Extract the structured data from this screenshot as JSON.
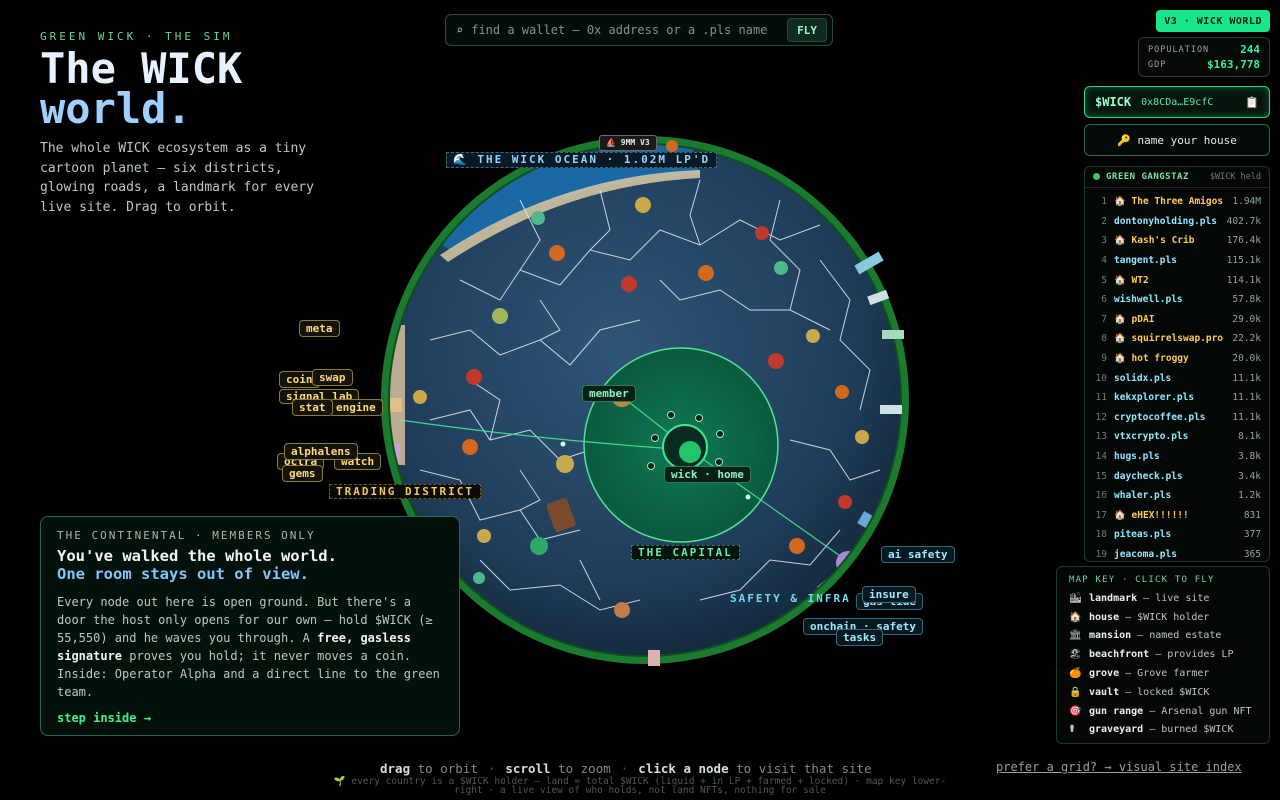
{
  "header": {
    "eyebrow": "GREEN WICK · THE SIM",
    "title_line1": "The WICK",
    "title_line2": "world.",
    "blurb": "The whole WICK ecosystem as a tiny cartoon planet — six districts, glowing roads, a landmark for every live site. Drag to orbit."
  },
  "search": {
    "icon": "search-icon",
    "placeholder": "find a wallet — 0x address or a .pls name",
    "button": "FLY"
  },
  "badge": "V3 · WICK WORLD",
  "stats": {
    "population_label": "POPULATION",
    "population": "244",
    "gdp_label": "GDP",
    "gdp": "$163,778"
  },
  "token": {
    "symbol": "$WICK",
    "address": "0x8CDa…E9cfC",
    "copy_icon": "📋"
  },
  "name_house": "🔑 name your house",
  "leaderboard": {
    "title": "GREEN GANGSTAZ",
    "subtitle": "$WICK held",
    "rows": [
      {
        "rank": "1",
        "name": "🏠 The Three Amigos",
        "value": "1.94M",
        "named": true
      },
      {
        "rank": "2",
        "name": "dontonyholding.pls",
        "value": "402.7k",
        "named": false
      },
      {
        "rank": "3",
        "name": "🏠 Kash's Crib",
        "value": "176.4k",
        "named": true
      },
      {
        "rank": "4",
        "name": "tangent.pls",
        "value": "115.1k",
        "named": false
      },
      {
        "rank": "5",
        "name": "🏠 WT2",
        "value": "114.1k",
        "named": true
      },
      {
        "rank": "6",
        "name": "wishwell.pls",
        "value": "57.8k",
        "named": false
      },
      {
        "rank": "7",
        "name": "🏠 pDAI",
        "value": "29.0k",
        "named": true
      },
      {
        "rank": "8",
        "name": "🏠 squirrelswap.pro",
        "value": "22.2k",
        "named": true
      },
      {
        "rank": "9",
        "name": "🏠 hot froggy",
        "value": "20.0k",
        "named": true
      },
      {
        "rank": "10",
        "name": "solidx.pls",
        "value": "11.1k",
        "named": false
      },
      {
        "rank": "11",
        "name": "kekxplorer.pls",
        "value": "11.1k",
        "named": false
      },
      {
        "rank": "12",
        "name": "cryptocoffee.pls",
        "value": "11.1k",
        "named": false
      },
      {
        "rank": "13",
        "name": "vtxcrypto.pls",
        "value": "8.1k",
        "named": false
      },
      {
        "rank": "14",
        "name": "hugs.pls",
        "value": "3.8k",
        "named": false
      },
      {
        "rank": "15",
        "name": "daycheck.pls",
        "value": "3.4k",
        "named": false
      },
      {
        "rank": "16",
        "name": "whaler.pls",
        "value": "1.2k",
        "named": false
      },
      {
        "rank": "17",
        "name": "🏠 eHEX!!!!!!",
        "value": "831",
        "named": true
      },
      {
        "rank": "18",
        "name": "piteas.pls",
        "value": "377",
        "named": false
      },
      {
        "rank": "19",
        "name": "jeacoma.pls",
        "value": "365",
        "named": false
      }
    ]
  },
  "mapkey": {
    "title": "MAP KEY · CLICK TO FLY",
    "items": [
      {
        "icon": "🏙",
        "name": "landmark",
        "desc": "— live site"
      },
      {
        "icon": "🏠",
        "name": "house",
        "desc": "— $WICK holder"
      },
      {
        "icon": "🏛",
        "name": "mansion",
        "desc": "— named estate"
      },
      {
        "icon": "🏖",
        "name": "beachfront",
        "desc": "— provides LP"
      },
      {
        "icon": "🍊",
        "name": "grove",
        "desc": "— Grove farmer"
      },
      {
        "icon": "🔒",
        "name": "vault",
        "desc": "— locked $WICK"
      },
      {
        "icon": "🎯",
        "name": "gun range",
        "desc": "— Arsenal gun NFT"
      },
      {
        "icon": "⚰",
        "name": "graveyard",
        "desc": "— burned $WICK"
      }
    ]
  },
  "continental": {
    "eyebrow": "THE CONTINENTAL · MEMBERS ONLY",
    "h1": "You've walked the whole world.",
    "h2": "One room stays out of view.",
    "p1": "Every node out here is open ground. But there's a door the host only opens for our own — hold $WICK (≥ 55,550) and he waves you through. A ",
    "p_bold1": "free, gasless signature",
    "p2": " proves you hold; it never moves a coin. Inside: Operator Alpha and a direct line to the green team.",
    "cta": "step inside →"
  },
  "globe_labels": {
    "ocean": "🌊 THE WICK OCEAN · 1.02M LP'D",
    "v3": "⛵ 9MM V3",
    "meta": "meta",
    "coin": "coin",
    "swap": "swap",
    "signal_lab": "signal lab",
    "stat": "stat",
    "engine": "engine",
    "alphalens": "alphalens",
    "octra": "octra",
    "watch": "watch",
    "gems": "gems",
    "trading": "TRADING DISTRICT",
    "member": "member",
    "wick_home": "wick · home",
    "capital": "THE CAPITAL",
    "safety_infra": "SAFETY & INFRA",
    "ai_safety": "ai safety",
    "insure": "insure",
    "gas_tide": "gas tide",
    "onchain_safety": "onchain · safety",
    "tasks": "tasks"
  },
  "footer": {
    "drag": "drag",
    "drag_rest": "to orbit",
    "scroll": "scroll",
    "scroll_rest": "to zoom",
    "click": "click a node",
    "click_rest": "to visit that site",
    "grid_link": "prefer a grid? → visual site index",
    "fine": "🌱 every country is a $WICK holder — land = total $WICK (liquid + in LP + farmed + locked) · map key lower-right · a live view of who holds, not land NFTs, nothing for sale"
  },
  "colors": {
    "accent": "#18e68a",
    "ocean": "#1b3a55",
    "land": "#2a4a68",
    "capital": "#0c6a4a",
    "gold": "#ffc857"
  }
}
